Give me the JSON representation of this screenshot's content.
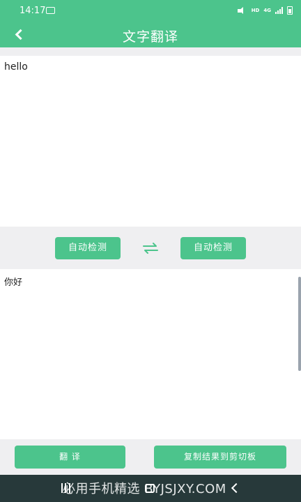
{
  "status_bar": {
    "time": "14:17",
    "hd": "HD",
    "network": "4G"
  },
  "app_bar": {
    "title": "文字翻译"
  },
  "source": {
    "text": "hello"
  },
  "languages": {
    "source_label": "自动检测",
    "target_label": "自动检测"
  },
  "result": {
    "text": "你好"
  },
  "actions": {
    "translate_label": "翻 译",
    "copy_label": "复制结果到剪切板"
  },
  "watermark": {
    "text": "必用手机精选 BYJSJXY.COM"
  },
  "colors": {
    "accent": "#4cc48c",
    "nav_bar": "#27393a",
    "background": "#efeff1"
  },
  "icons": {
    "back": "back-icon",
    "swap": "swap-arrows-icon"
  }
}
